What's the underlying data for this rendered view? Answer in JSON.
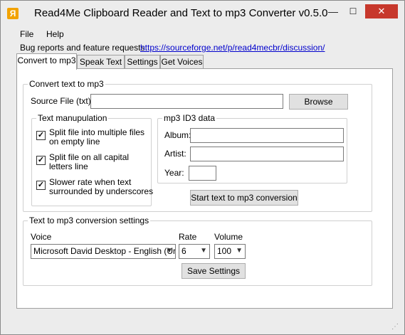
{
  "window": {
    "title": "Read4Me Clipboard Reader and Text to mp3 Converter v0.5.0",
    "icon_letter": "Я",
    "controls": {
      "minimize": "—",
      "maximize": "☐",
      "close": "✕"
    }
  },
  "menu": {
    "items": [
      "File",
      "Help"
    ]
  },
  "bug_report": {
    "label": "Bug reports and feature requests:",
    "link": "https://sourceforge.net/p/read4mecbr/discussion/"
  },
  "tabs": [
    {
      "label": "Convert to mp3",
      "active": true
    },
    {
      "label": "Speak Text",
      "active": false
    },
    {
      "label": "Settings",
      "active": false
    },
    {
      "label": "Get Voices",
      "active": false
    }
  ],
  "convert_group": {
    "title": "Convert text to mp3",
    "source_label": "Source File (txt)",
    "source_value": "",
    "browse_label": "Browse",
    "text_manip": {
      "title": "Text manupulation",
      "options": [
        {
          "label": "Split file into multiple files on empty line",
          "checked": true
        },
        {
          "label": "Split file on all capital letters line",
          "checked": true
        },
        {
          "label": "Slower rate when text surrounded by underscores",
          "checked": true
        }
      ]
    },
    "id3": {
      "title": "mp3 ID3 data",
      "album_label": "Album:",
      "album_value": "",
      "artist_label": "Artist:",
      "artist_value": "",
      "year_label": "Year:",
      "year_value": ""
    },
    "start_label": "Start text to mp3 conversion"
  },
  "conversion_settings": {
    "title": "Text to mp3 conversion settings",
    "voice_label": "Voice",
    "voice_value": "Microsoft David Desktop - English (Ur",
    "rate_label": "Rate",
    "rate_value": "6",
    "volume_label": "Volume",
    "volume_value": "100",
    "save_label": "Save Settings"
  },
  "status": {
    "grip": "⋰"
  }
}
